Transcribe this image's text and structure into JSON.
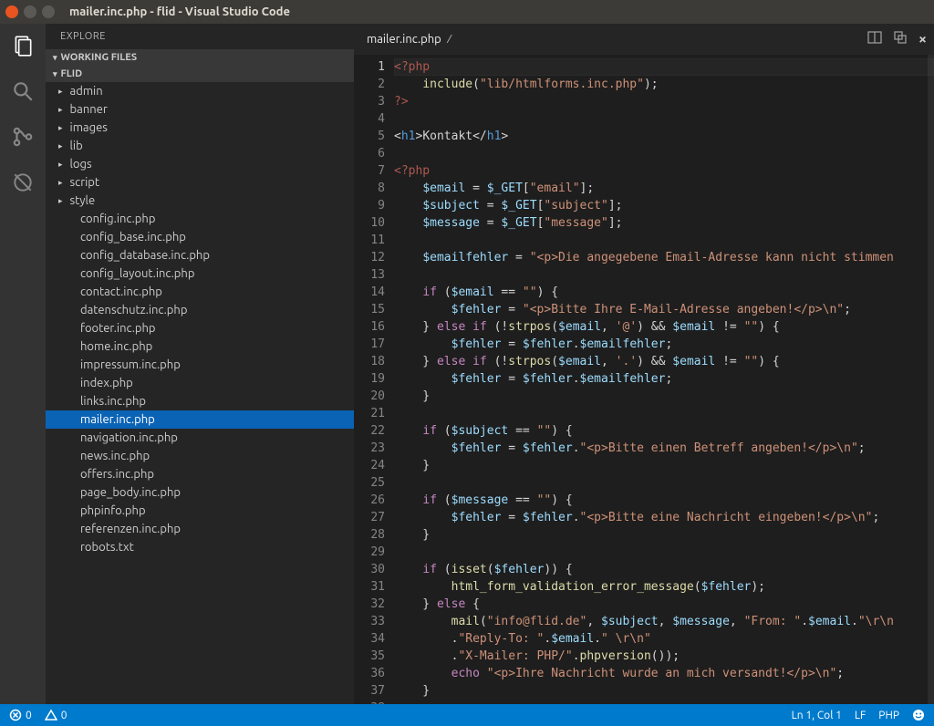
{
  "window": {
    "title": "mailer.inc.php - flid - Visual Studio Code"
  },
  "sidebar": {
    "title": "EXPLORE",
    "working_files_label": "WORKING FILES",
    "project_label": "FLID",
    "folders": [
      "admin",
      "banner",
      "images",
      "lib",
      "logs",
      "script",
      "style"
    ],
    "files": [
      "config.inc.php",
      "config_base.inc.php",
      "config_database.inc.php",
      "config_layout.inc.php",
      "contact.inc.php",
      "datenschutz.inc.php",
      "footer.inc.php",
      "home.inc.php",
      "impressum.inc.php",
      "index.php",
      "links.inc.php",
      "mailer.inc.php",
      "navigation.inc.php",
      "news.inc.php",
      "offers.inc.php",
      "page_body.inc.php",
      "phpinfo.php",
      "referenzen.inc.php",
      "robots.txt"
    ],
    "selected_file": "mailer.inc.php"
  },
  "tab": {
    "label": "mailer.inc.php"
  },
  "statusbar": {
    "errors": "0",
    "warnings": "0",
    "position": "Ln 1, Col 1",
    "encoding": "LF",
    "language": "PHP"
  },
  "code": {
    "lines": [
      [
        [
          "php-tag",
          "<?php"
        ]
      ],
      [
        [
          "pl",
          "    "
        ],
        [
          "fn",
          "include"
        ],
        [
          "pl",
          "("
        ],
        [
          "str",
          "\"lib/htmlforms.inc.php\""
        ],
        [
          "pl",
          ");"
        ]
      ],
      [
        [
          "php-tag",
          "?>"
        ]
      ],
      [],
      [
        [
          "pl",
          "<"
        ],
        [
          "html-tag",
          "h1"
        ],
        [
          "pl",
          ">"
        ],
        [
          "pl",
          "Kontakt"
        ],
        [
          "pl",
          "</"
        ],
        [
          "html-tag",
          "h1"
        ],
        [
          "pl",
          ">"
        ]
      ],
      [],
      [
        [
          "php-tag",
          "<?php"
        ]
      ],
      [
        [
          "pl",
          "    "
        ],
        [
          "var",
          "$email"
        ],
        [
          "pl",
          " = "
        ],
        [
          "var",
          "$_GET"
        ],
        [
          "pl",
          "["
        ],
        [
          "str",
          "\"email\""
        ],
        [
          "pl",
          "];"
        ]
      ],
      [
        [
          "pl",
          "    "
        ],
        [
          "var",
          "$subject"
        ],
        [
          "pl",
          " = "
        ],
        [
          "var",
          "$_GET"
        ],
        [
          "pl",
          "["
        ],
        [
          "str",
          "\"subject\""
        ],
        [
          "pl",
          "];"
        ]
      ],
      [
        [
          "pl",
          "    "
        ],
        [
          "var",
          "$message"
        ],
        [
          "pl",
          " = "
        ],
        [
          "var",
          "$_GET"
        ],
        [
          "pl",
          "["
        ],
        [
          "str",
          "\"message\""
        ],
        [
          "pl",
          "];"
        ]
      ],
      [],
      [
        [
          "pl",
          "    "
        ],
        [
          "var",
          "$emailfehler"
        ],
        [
          "pl",
          " = "
        ],
        [
          "str",
          "\"<p>Die angegebene Email-Adresse kann nicht stimmen"
        ]
      ],
      [],
      [
        [
          "pl",
          "    "
        ],
        [
          "kw",
          "if"
        ],
        [
          "pl",
          " ("
        ],
        [
          "var",
          "$email"
        ],
        [
          "pl",
          " == "
        ],
        [
          "str",
          "\"\""
        ],
        [
          "pl",
          ") {"
        ]
      ],
      [
        [
          "pl",
          "        "
        ],
        [
          "var",
          "$fehler"
        ],
        [
          "pl",
          " = "
        ],
        [
          "str",
          "\"<p>Bitte Ihre E-Mail-Adresse angeben!</p>\\n\""
        ],
        [
          "pl",
          ";"
        ]
      ],
      [
        [
          "pl",
          "    } "
        ],
        [
          "kw",
          "else"
        ],
        [
          "pl",
          " "
        ],
        [
          "kw",
          "if"
        ],
        [
          "pl",
          " (!"
        ],
        [
          "fn",
          "strpos"
        ],
        [
          "pl",
          "("
        ],
        [
          "var",
          "$email"
        ],
        [
          "pl",
          ", "
        ],
        [
          "str",
          "'@'"
        ],
        [
          "pl",
          ") && "
        ],
        [
          "var",
          "$email"
        ],
        [
          "pl",
          " != "
        ],
        [
          "str",
          "\"\""
        ],
        [
          "pl",
          ") {"
        ]
      ],
      [
        [
          "pl",
          "        "
        ],
        [
          "var",
          "$fehler"
        ],
        [
          "pl",
          " = "
        ],
        [
          "var",
          "$fehler"
        ],
        [
          "pl",
          "."
        ],
        [
          "var",
          "$emailfehler"
        ],
        [
          "pl",
          ";"
        ]
      ],
      [
        [
          "pl",
          "    } "
        ],
        [
          "kw",
          "else"
        ],
        [
          "pl",
          " "
        ],
        [
          "kw",
          "if"
        ],
        [
          "pl",
          " (!"
        ],
        [
          "fn",
          "strpos"
        ],
        [
          "pl",
          "("
        ],
        [
          "var",
          "$email"
        ],
        [
          "pl",
          ", "
        ],
        [
          "str",
          "'.'"
        ],
        [
          "pl",
          ") && "
        ],
        [
          "var",
          "$email"
        ],
        [
          "pl",
          " != "
        ],
        [
          "str",
          "\"\""
        ],
        [
          "pl",
          ") {"
        ]
      ],
      [
        [
          "pl",
          "        "
        ],
        [
          "var",
          "$fehler"
        ],
        [
          "pl",
          " = "
        ],
        [
          "var",
          "$fehler"
        ],
        [
          "pl",
          "."
        ],
        [
          "var",
          "$emailfehler"
        ],
        [
          "pl",
          ";"
        ]
      ],
      [
        [
          "pl",
          "    }"
        ]
      ],
      [],
      [
        [
          "pl",
          "    "
        ],
        [
          "kw",
          "if"
        ],
        [
          "pl",
          " ("
        ],
        [
          "var",
          "$subject"
        ],
        [
          "pl",
          " == "
        ],
        [
          "str",
          "\"\""
        ],
        [
          "pl",
          ") {"
        ]
      ],
      [
        [
          "pl",
          "        "
        ],
        [
          "var",
          "$fehler"
        ],
        [
          "pl",
          " = "
        ],
        [
          "var",
          "$fehler"
        ],
        [
          "pl",
          "."
        ],
        [
          "str",
          "\"<p>Bitte einen Betreff angeben!</p>\\n\""
        ],
        [
          "pl",
          ";"
        ]
      ],
      [
        [
          "pl",
          "    }"
        ]
      ],
      [],
      [
        [
          "pl",
          "    "
        ],
        [
          "kw",
          "if"
        ],
        [
          "pl",
          " ("
        ],
        [
          "var",
          "$message"
        ],
        [
          "pl",
          " == "
        ],
        [
          "str",
          "\"\""
        ],
        [
          "pl",
          ") {"
        ]
      ],
      [
        [
          "pl",
          "        "
        ],
        [
          "var",
          "$fehler"
        ],
        [
          "pl",
          " = "
        ],
        [
          "var",
          "$fehler"
        ],
        [
          "pl",
          "."
        ],
        [
          "str",
          "\"<p>Bitte eine Nachricht eingeben!</p>\\n\""
        ],
        [
          "pl",
          ";"
        ]
      ],
      [
        [
          "pl",
          "    }"
        ]
      ],
      [],
      [
        [
          "pl",
          "    "
        ],
        [
          "kw",
          "if"
        ],
        [
          "pl",
          " ("
        ],
        [
          "fn",
          "isset"
        ],
        [
          "pl",
          "("
        ],
        [
          "var",
          "$fehler"
        ],
        [
          "pl",
          ")) {"
        ]
      ],
      [
        [
          "pl",
          "        "
        ],
        [
          "fn",
          "html_form_validation_error_message"
        ],
        [
          "pl",
          "("
        ],
        [
          "var",
          "$fehler"
        ],
        [
          "pl",
          ");"
        ]
      ],
      [
        [
          "pl",
          "    } "
        ],
        [
          "kw",
          "else"
        ],
        [
          "pl",
          " {"
        ]
      ],
      [
        [
          "pl",
          "        "
        ],
        [
          "fn",
          "mail"
        ],
        [
          "pl",
          "("
        ],
        [
          "str",
          "\"info@flid.de\""
        ],
        [
          "pl",
          ", "
        ],
        [
          "var",
          "$subject"
        ],
        [
          "pl",
          ", "
        ],
        [
          "var",
          "$message"
        ],
        [
          "pl",
          ", "
        ],
        [
          "str",
          "\"From: \""
        ],
        [
          "pl",
          "."
        ],
        [
          "var",
          "$email"
        ],
        [
          "pl",
          "."
        ],
        [
          "str",
          "\"\\r\\n"
        ]
      ],
      [
        [
          "pl",
          "        ."
        ],
        [
          "str",
          "\"Reply-To: \""
        ],
        [
          "pl",
          "."
        ],
        [
          "var",
          "$email"
        ],
        [
          "pl",
          "."
        ],
        [
          "str",
          "\" \\r\\n\""
        ]
      ],
      [
        [
          "pl",
          "        ."
        ],
        [
          "str",
          "\"X-Mailer: PHP/\""
        ],
        [
          "pl",
          "."
        ],
        [
          "fn",
          "phpversion"
        ],
        [
          "pl",
          "());"
        ]
      ],
      [
        [
          "pl",
          "        "
        ],
        [
          "kw",
          "echo"
        ],
        [
          "pl",
          " "
        ],
        [
          "str",
          "\"<p>Ihre Nachricht wurde an mich versandt!</p>\\n\""
        ],
        [
          "pl",
          ";"
        ]
      ],
      [
        [
          "pl",
          "    }"
        ]
      ],
      []
    ]
  }
}
